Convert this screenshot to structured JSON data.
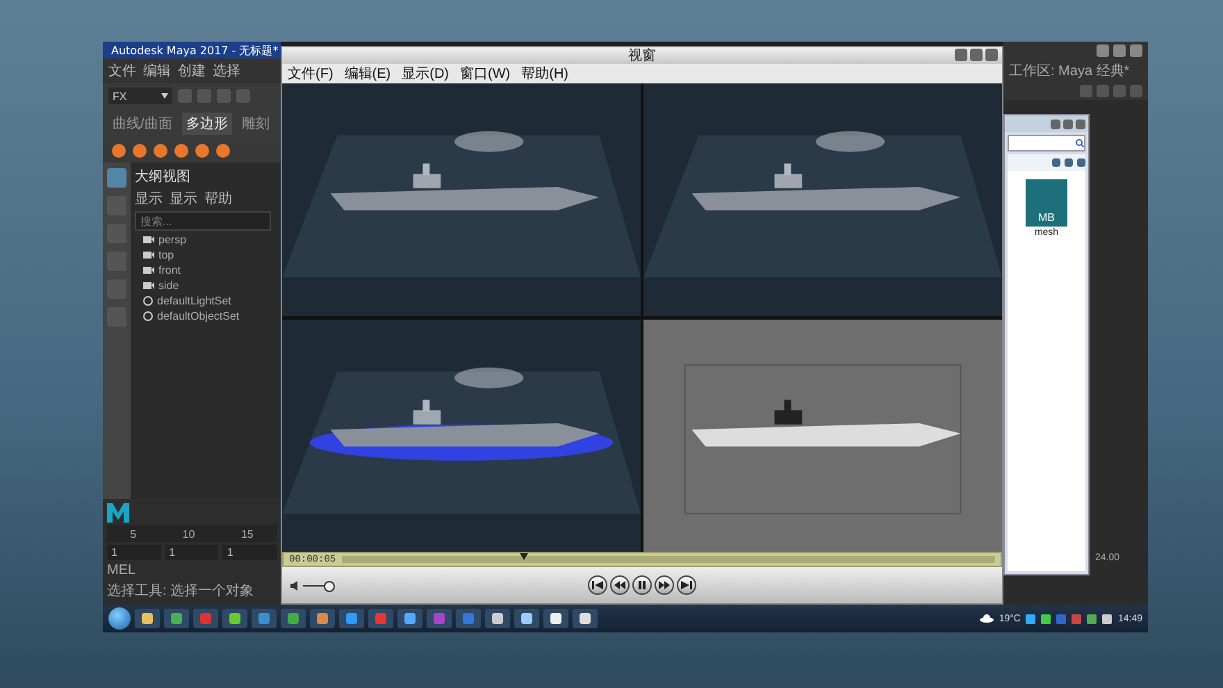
{
  "maya": {
    "title": "Autodesk Maya 2017 - 无标题*",
    "menu": [
      "文件",
      "编辑",
      "创建",
      "选择"
    ],
    "shelf_set": "FX",
    "shelf_tabs": [
      {
        "label": "曲线/曲面",
        "selected": false
      },
      {
        "label": "多边形",
        "selected": true
      },
      {
        "label": "雕刻",
        "selected": false
      }
    ],
    "outliner": {
      "title": "大纲视图",
      "menu": [
        "显示",
        "显示",
        "帮助"
      ],
      "search": {
        "placeholder": "搜索..."
      },
      "items": [
        {
          "kind": "camera",
          "label": "persp"
        },
        {
          "kind": "camera",
          "label": "top"
        },
        {
          "kind": "camera",
          "label": "front"
        },
        {
          "kind": "camera",
          "label": "side"
        },
        {
          "kind": "set",
          "label": "defaultLightSet"
        },
        {
          "kind": "set",
          "label": "defaultObjectSet"
        }
      ]
    },
    "time_ticks": [
      "5",
      "10",
      "15"
    ],
    "range_fields": [
      "1",
      "1",
      "1"
    ],
    "end_time": "24.00",
    "command_language": "MEL",
    "help_line": "选择工具: 选择一个对象",
    "workspace": "工作区: Maya 经典*"
  },
  "player": {
    "title": "视窗",
    "menu": [
      "文件(F)",
      "编辑(E)",
      "显示(D)",
      "窗口(W)",
      "帮助(H)"
    ],
    "viewports": [
      {
        "kind": "ocean"
      },
      {
        "kind": "ocean"
      },
      {
        "kind": "glow"
      },
      {
        "kind": "gray"
      }
    ],
    "time": "00:00:05",
    "progress": {
      "level": 0.28
    },
    "volume": {
      "level": 0.85
    },
    "playing": true
  },
  "explorer": {
    "file": {
      "badge": "MB",
      "name": "mesh"
    }
  },
  "taskbar": {
    "weather": "19°C",
    "clock": "14:49"
  }
}
